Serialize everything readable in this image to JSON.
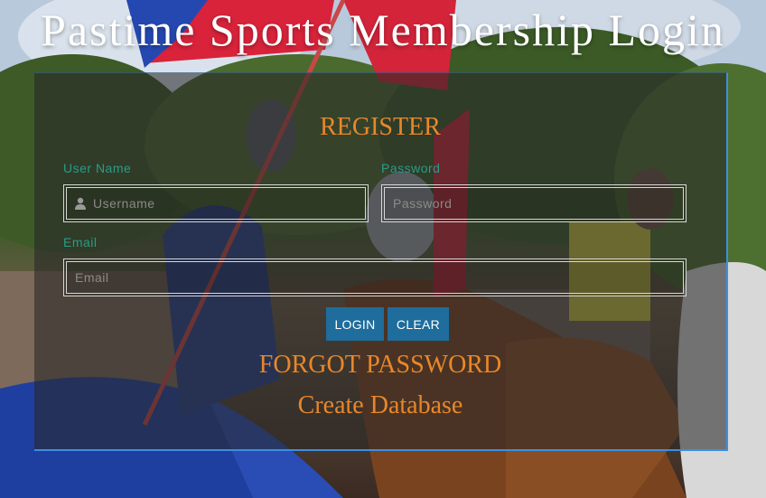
{
  "header": {
    "title": "Pastime Sports Membership Login"
  },
  "form": {
    "heading": "REGISTER",
    "username": {
      "label": "User Name",
      "placeholder": "Username",
      "value": ""
    },
    "password": {
      "label": "Password",
      "placeholder": "Password",
      "value": ""
    },
    "email": {
      "label": "Email",
      "placeholder": "Email",
      "value": ""
    },
    "buttons": {
      "login": "LOGIN",
      "clear": "CLEAR"
    },
    "links": {
      "forgot_password": "FORGOT PASSWORD",
      "create_database": "Create Database"
    }
  },
  "colors": {
    "accent_orange": "#e8872a",
    "label_teal": "#2a9b8a",
    "button_blue": "#1e6d9c",
    "panel_border": "#3c8fe0"
  },
  "icons": {
    "username_field": "user-icon"
  }
}
